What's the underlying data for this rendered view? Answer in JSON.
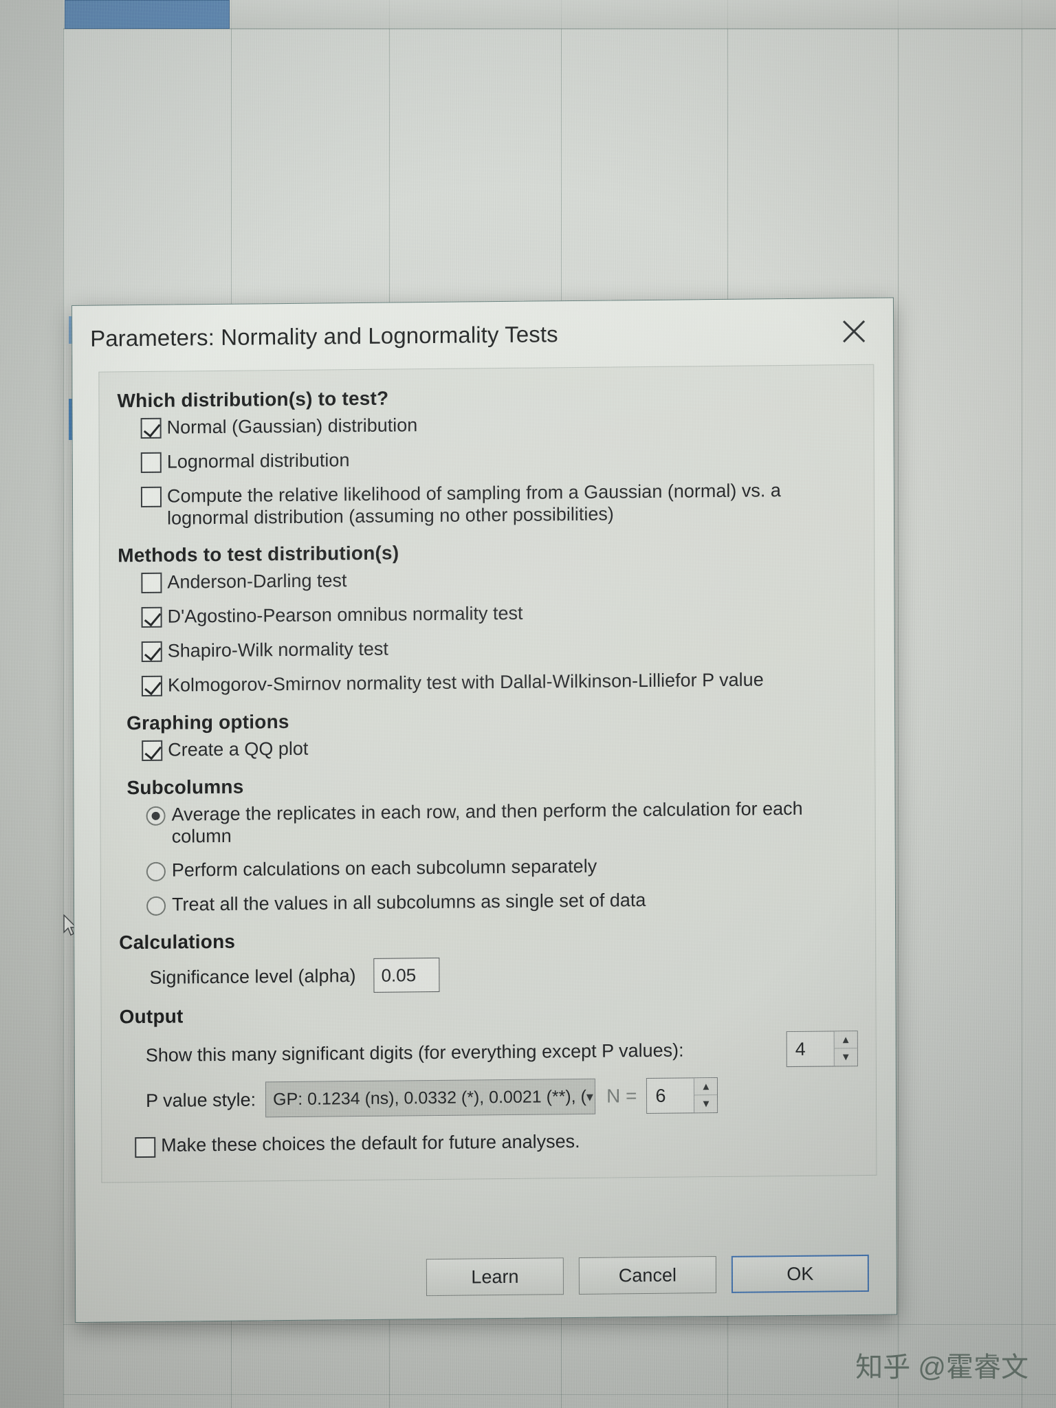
{
  "window": {
    "title": "Parameters: Normality and Lognormality Tests",
    "close_icon": "close-icon"
  },
  "sections": {
    "distribution": {
      "heading": "Which distribution(s) to test?",
      "options": [
        {
          "label": "Normal (Gaussian) distribution",
          "checked": true
        },
        {
          "label": "Lognormal distribution",
          "checked": false
        },
        {
          "label": "Compute the relative likelihood of sampling from a Gaussian (normal) vs. a lognormal distribution (assuming no other possibilities)",
          "checked": false
        }
      ]
    },
    "methods": {
      "heading": "Methods to test distribution(s)",
      "options": [
        {
          "label": "Anderson-Darling test",
          "checked": false
        },
        {
          "label": "D'Agostino-Pearson omnibus normality test",
          "checked": true
        },
        {
          "label": "Shapiro-Wilk normality test",
          "checked": true
        },
        {
          "label": "Kolmogorov-Smirnov normality test with Dallal-Wilkinson-Lilliefor P value",
          "checked": true
        }
      ]
    },
    "graphing": {
      "heading": "Graphing options",
      "options": [
        {
          "label": "Create a QQ plot",
          "checked": true
        }
      ]
    },
    "subcolumns": {
      "heading": "Subcolumns",
      "options": [
        {
          "label": "Average the replicates in each row, and then perform the calculation for each column",
          "selected": true
        },
        {
          "label": "Perform calculations on each subcolumn separately",
          "selected": false
        },
        {
          "label": "Treat all the values in all subcolumns as single set of data",
          "selected": false
        }
      ]
    },
    "calculations": {
      "heading": "Calculations",
      "alpha_label": "Significance level (alpha)",
      "alpha_value": "0.05"
    },
    "output": {
      "heading": "Output",
      "sig_digits_label": "Show this many significant digits (for everything except P values):",
      "sig_digits_value": "4",
      "pvalue_style_label": "P value style:",
      "pvalue_style_value": "GP: 0.1234 (ns), 0.0332 (*), 0.0021 (**), (",
      "n_label": "N =",
      "n_value": "6"
    },
    "default_checkbox": {
      "label": "Make these choices the default for future analyses.",
      "checked": false
    }
  },
  "footer": {
    "learn_label": "Learn",
    "cancel_label": "Cancel",
    "ok_label": "OK"
  },
  "watermark": {
    "text": "知乎 @霍睿文"
  },
  "colors": {
    "accent": "#3a6fb5",
    "selection": "#4f7fb3",
    "dialog_bg": "#dfe3de",
    "text": "#14161a"
  }
}
